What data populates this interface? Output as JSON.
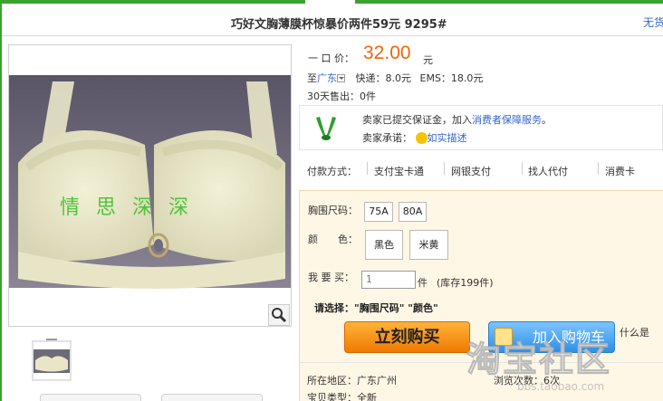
{
  "header": {
    "title": "巧好文胸薄膜杯惊暴价两件59元 9295#",
    "right_link": "无货"
  },
  "gallery": {
    "watermark_text": [
      "情",
      "思",
      "深",
      "深"
    ],
    "zoom_icon": "magnifier-icon"
  },
  "price": {
    "label": "一 口 价：",
    "value": "32.00",
    "unit": "元"
  },
  "shipping": {
    "to_label": "至",
    "region": "广东",
    "express": "快递：8.0元",
    "ems": "EMS：18.0元"
  },
  "sales": {
    "label": "30天售出：",
    "value": "0件"
  },
  "guarantee": {
    "line1_prefix": "卖家已提交保证金，加入",
    "line1_link": "消费者保障服务",
    "line1_suffix": "。",
    "line2_label": "卖家承诺：",
    "line2_link": "如实描述",
    "icon": "hands-icon"
  },
  "payment": {
    "label": "付款方式：",
    "methods": [
      "支付宝卡通",
      "网银支付",
      "找人代付",
      "消费卡"
    ]
  },
  "sku": {
    "size_label": "胸围尺码：",
    "sizes": [
      "75A",
      "80A"
    ],
    "color_label": "颜　　色：",
    "colors": [
      "黑色",
      "米黄"
    ],
    "buy_label": "我 要 买：",
    "quantity": "1",
    "unit": "件",
    "stock": "(库存199件)",
    "select_prompt": "请选择：\"胸围尺码\" \"颜色\"",
    "buy_now": "立刻购买",
    "add_cart": "加入购物车",
    "more": "什么是"
  },
  "details": {
    "location_label": "所在地区：",
    "location": "广东广州",
    "views_label": "浏览次数：",
    "views": "6次",
    "type_label": "宝贝类型：",
    "type": "全新"
  },
  "site_watermark": {
    "text": "淘宝社区",
    "url_text": "bbs.taobao.com"
  },
  "colors": {
    "brand_green": "#3aa32e",
    "price_orange": "#f0650a",
    "link_blue": "#3366cc",
    "sku_bg": "#fff7e6"
  }
}
